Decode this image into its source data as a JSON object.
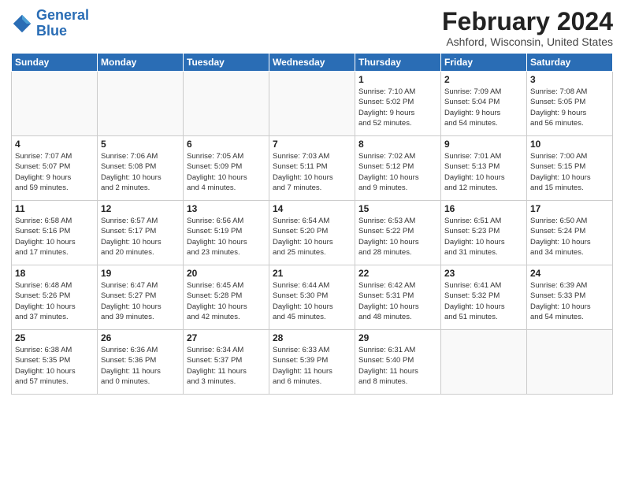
{
  "logo": {
    "line1": "General",
    "line2": "Blue"
  },
  "title": "February 2024",
  "subtitle": "Ashford, Wisconsin, United States",
  "days_of_week": [
    "Sunday",
    "Monday",
    "Tuesday",
    "Wednesday",
    "Thursday",
    "Friday",
    "Saturday"
  ],
  "weeks": [
    [
      {
        "day": "",
        "info": ""
      },
      {
        "day": "",
        "info": ""
      },
      {
        "day": "",
        "info": ""
      },
      {
        "day": "",
        "info": ""
      },
      {
        "day": "1",
        "info": "Sunrise: 7:10 AM\nSunset: 5:02 PM\nDaylight: 9 hours\nand 52 minutes."
      },
      {
        "day": "2",
        "info": "Sunrise: 7:09 AM\nSunset: 5:04 PM\nDaylight: 9 hours\nand 54 minutes."
      },
      {
        "day": "3",
        "info": "Sunrise: 7:08 AM\nSunset: 5:05 PM\nDaylight: 9 hours\nand 56 minutes."
      }
    ],
    [
      {
        "day": "4",
        "info": "Sunrise: 7:07 AM\nSunset: 5:07 PM\nDaylight: 9 hours\nand 59 minutes."
      },
      {
        "day": "5",
        "info": "Sunrise: 7:06 AM\nSunset: 5:08 PM\nDaylight: 10 hours\nand 2 minutes."
      },
      {
        "day": "6",
        "info": "Sunrise: 7:05 AM\nSunset: 5:09 PM\nDaylight: 10 hours\nand 4 minutes."
      },
      {
        "day": "7",
        "info": "Sunrise: 7:03 AM\nSunset: 5:11 PM\nDaylight: 10 hours\nand 7 minutes."
      },
      {
        "day": "8",
        "info": "Sunrise: 7:02 AM\nSunset: 5:12 PM\nDaylight: 10 hours\nand 9 minutes."
      },
      {
        "day": "9",
        "info": "Sunrise: 7:01 AM\nSunset: 5:13 PM\nDaylight: 10 hours\nand 12 minutes."
      },
      {
        "day": "10",
        "info": "Sunrise: 7:00 AM\nSunset: 5:15 PM\nDaylight: 10 hours\nand 15 minutes."
      }
    ],
    [
      {
        "day": "11",
        "info": "Sunrise: 6:58 AM\nSunset: 5:16 PM\nDaylight: 10 hours\nand 17 minutes."
      },
      {
        "day": "12",
        "info": "Sunrise: 6:57 AM\nSunset: 5:17 PM\nDaylight: 10 hours\nand 20 minutes."
      },
      {
        "day": "13",
        "info": "Sunrise: 6:56 AM\nSunset: 5:19 PM\nDaylight: 10 hours\nand 23 minutes."
      },
      {
        "day": "14",
        "info": "Sunrise: 6:54 AM\nSunset: 5:20 PM\nDaylight: 10 hours\nand 25 minutes."
      },
      {
        "day": "15",
        "info": "Sunrise: 6:53 AM\nSunset: 5:22 PM\nDaylight: 10 hours\nand 28 minutes."
      },
      {
        "day": "16",
        "info": "Sunrise: 6:51 AM\nSunset: 5:23 PM\nDaylight: 10 hours\nand 31 minutes."
      },
      {
        "day": "17",
        "info": "Sunrise: 6:50 AM\nSunset: 5:24 PM\nDaylight: 10 hours\nand 34 minutes."
      }
    ],
    [
      {
        "day": "18",
        "info": "Sunrise: 6:48 AM\nSunset: 5:26 PM\nDaylight: 10 hours\nand 37 minutes."
      },
      {
        "day": "19",
        "info": "Sunrise: 6:47 AM\nSunset: 5:27 PM\nDaylight: 10 hours\nand 39 minutes."
      },
      {
        "day": "20",
        "info": "Sunrise: 6:45 AM\nSunset: 5:28 PM\nDaylight: 10 hours\nand 42 minutes."
      },
      {
        "day": "21",
        "info": "Sunrise: 6:44 AM\nSunset: 5:30 PM\nDaylight: 10 hours\nand 45 minutes."
      },
      {
        "day": "22",
        "info": "Sunrise: 6:42 AM\nSunset: 5:31 PM\nDaylight: 10 hours\nand 48 minutes."
      },
      {
        "day": "23",
        "info": "Sunrise: 6:41 AM\nSunset: 5:32 PM\nDaylight: 10 hours\nand 51 minutes."
      },
      {
        "day": "24",
        "info": "Sunrise: 6:39 AM\nSunset: 5:33 PM\nDaylight: 10 hours\nand 54 minutes."
      }
    ],
    [
      {
        "day": "25",
        "info": "Sunrise: 6:38 AM\nSunset: 5:35 PM\nDaylight: 10 hours\nand 57 minutes."
      },
      {
        "day": "26",
        "info": "Sunrise: 6:36 AM\nSunset: 5:36 PM\nDaylight: 11 hours\nand 0 minutes."
      },
      {
        "day": "27",
        "info": "Sunrise: 6:34 AM\nSunset: 5:37 PM\nDaylight: 11 hours\nand 3 minutes."
      },
      {
        "day": "28",
        "info": "Sunrise: 6:33 AM\nSunset: 5:39 PM\nDaylight: 11 hours\nand 6 minutes."
      },
      {
        "day": "29",
        "info": "Sunrise: 6:31 AM\nSunset: 5:40 PM\nDaylight: 11 hours\nand 8 minutes."
      },
      {
        "day": "",
        "info": ""
      },
      {
        "day": "",
        "info": ""
      }
    ]
  ]
}
